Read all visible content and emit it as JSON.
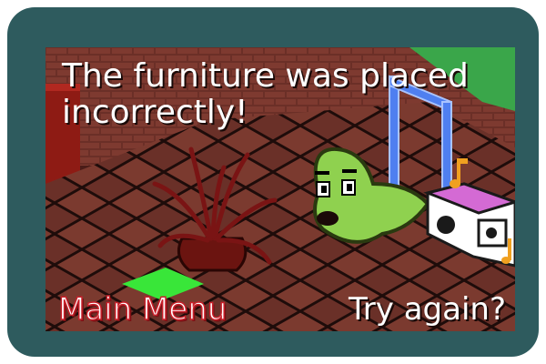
{
  "message": "The furniture was placed incorrectly!",
  "buttons": {
    "main_menu": "Main Menu",
    "try_again": "Try again?"
  },
  "colors": {
    "frame": "#2e5b5e",
    "floor_dark": "#5b2a22",
    "floor_light": "#7a3c30",
    "blob": "#8fd14f",
    "marker": "#39e639",
    "plant": "#7a1414",
    "boombox": "#d46ad4",
    "music_note": "#f0a020",
    "pipe": "#4f7ff0"
  },
  "icons": [
    "plant-sprite",
    "blob-character",
    "boombox-sprite",
    "music-note-icon",
    "green-tile-marker",
    "pipe-arch"
  ]
}
